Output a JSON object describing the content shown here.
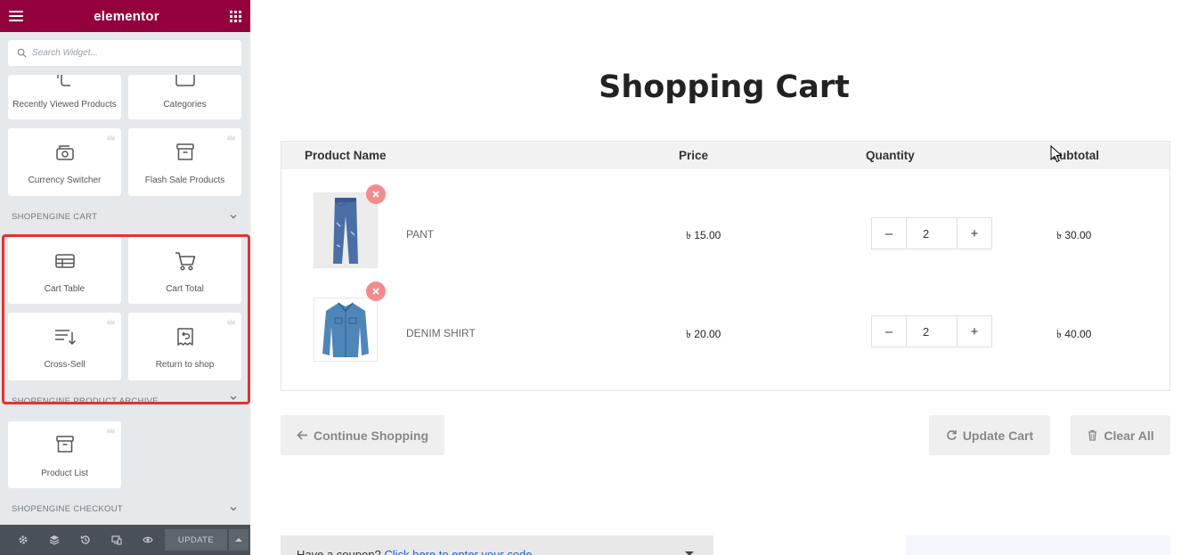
{
  "sidebar": {
    "brand": "elementor",
    "search_placeholder": "Search Widget...",
    "widgets_top": [
      {
        "label": "Recently Viewed Products",
        "icon": "recently-viewed-icon"
      },
      {
        "label": "Categories",
        "icon": "categories-icon"
      },
      {
        "label": "Currency Switcher",
        "icon": "currency-switcher-icon",
        "pro": true
      },
      {
        "label": "Flash Sale Products",
        "icon": "flash-sale-icon",
        "pro": true
      }
    ],
    "section_cart": "SHOPENGINE CART",
    "widgets_cart": [
      {
        "label": "Cart Table",
        "icon": "cart-table-icon"
      },
      {
        "label": "Cart Total",
        "icon": "cart-total-icon"
      },
      {
        "label": "Cross-Sell",
        "icon": "cross-sell-icon",
        "pro": true
      },
      {
        "label": "Return to shop",
        "icon": "return-to-shop-icon",
        "pro": true
      }
    ],
    "section_archive": "SHOPENGINE PRODUCT ARCHIVE",
    "widgets_archive": [
      {
        "label": "Product List",
        "icon": "product-list-icon",
        "pro": true
      }
    ],
    "section_checkout": "SHOPENGINE CHECKOUT",
    "bottom_bar": {
      "icons": [
        "settings-icon",
        "layers-icon",
        "history-icon",
        "responsive-icon",
        "preview-icon"
      ],
      "update_label": "UPDATE"
    }
  },
  "main": {
    "title": "Shopping Cart",
    "table": {
      "headers": [
        "Product Name",
        "Price",
        "Quantity",
        "Subtotal"
      ],
      "rows": [
        {
          "name": "PANT",
          "price": "৳ 15.00",
          "quantity": "2",
          "subtotal": "৳ 30.00",
          "image": "pant-image"
        },
        {
          "name": "DENIM SHIRT",
          "price": "৳ 20.00",
          "quantity": "2",
          "subtotal": "৳ 40.00",
          "image": "denim-shirt-image"
        }
      ],
      "minus": "–",
      "plus": "+"
    },
    "buttons": {
      "continue": "Continue Shopping",
      "update": "Update Cart",
      "clear": "Clear All"
    },
    "coupon": {
      "text": "Have a coupon?",
      "link": "Click here to enter your code"
    }
  },
  "colors": {
    "brand_bar": "#93003c",
    "highlight": "#e03232",
    "remove": "#f08c8c",
    "link": "#1f5bd6"
  }
}
